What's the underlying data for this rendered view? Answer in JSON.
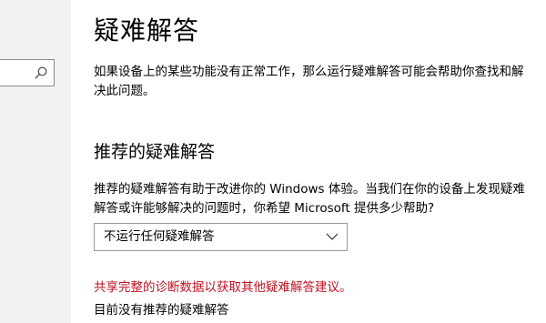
{
  "sidebar": {
    "search": {
      "placeholder": "",
      "icon": "search-icon"
    }
  },
  "page": {
    "title": "疑难解答",
    "intro": "如果设备上的某些功能没有正常工作，那么运行疑难解答可能会帮助你查找和解决此问题。"
  },
  "recommended": {
    "heading": "推荐的疑难解答",
    "description": "推荐的疑难解答有助于改进你的 Windows 体验。当我们在你的设备上发现疑难解答或许能够解决的问题时，你希望 Microsoft 提供多少帮助?",
    "dropdown": {
      "selected": "不运行任何疑难解答",
      "icon": "chevron-down-icon"
    },
    "warning": "共享完整的诊断数据以获取其他疑难解答建议。",
    "status": "目前没有推荐的疑难解答"
  },
  "colors": {
    "sidebar_bg": "#f2f2f2",
    "warning": "#c50f1f"
  }
}
